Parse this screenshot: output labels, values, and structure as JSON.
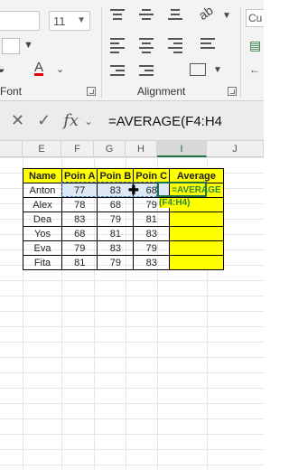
{
  "ribbon": {
    "font_size": "11",
    "font_group_label": "Font",
    "alignment_group_label": "Alignment",
    "number_format_partial": "Cu"
  },
  "formula_bar": {
    "formula": "=AVERAGE(F4:H4"
  },
  "columns": [
    "E",
    "F",
    "G",
    "H",
    "I",
    "J"
  ],
  "selected_column": "I",
  "table": {
    "headers": [
      "Name",
      "Poin A",
      "Poin B",
      "Poin C",
      "Average"
    ],
    "rows": [
      {
        "name": "Anton",
        "a": "77",
        "b": "83",
        "c": "68",
        "avg": "=AVERAGE"
      },
      {
        "name": "Alex",
        "a": "78",
        "b": "68",
        "c": "79",
        "avg": ""
      },
      {
        "name": "Dea",
        "a": "83",
        "b": "79",
        "c": "81",
        "avg": ""
      },
      {
        "name": "Yos",
        "a": "68",
        "b": "81",
        "c": "83",
        "avg": ""
      },
      {
        "name": "Eva",
        "a": "79",
        "b": "83",
        "c": "79",
        "avg": ""
      },
      {
        "name": "Fita",
        "a": "81",
        "b": "79",
        "c": "83",
        "avg": ""
      }
    ],
    "formula_tip": "(F4:H4)"
  },
  "colors": {
    "header_fill": "#ffff00",
    "average_fill": "#ffff00",
    "active_border": "#217346",
    "range_outline": "#3a78c8",
    "formula_text": "#2e8b3d"
  }
}
